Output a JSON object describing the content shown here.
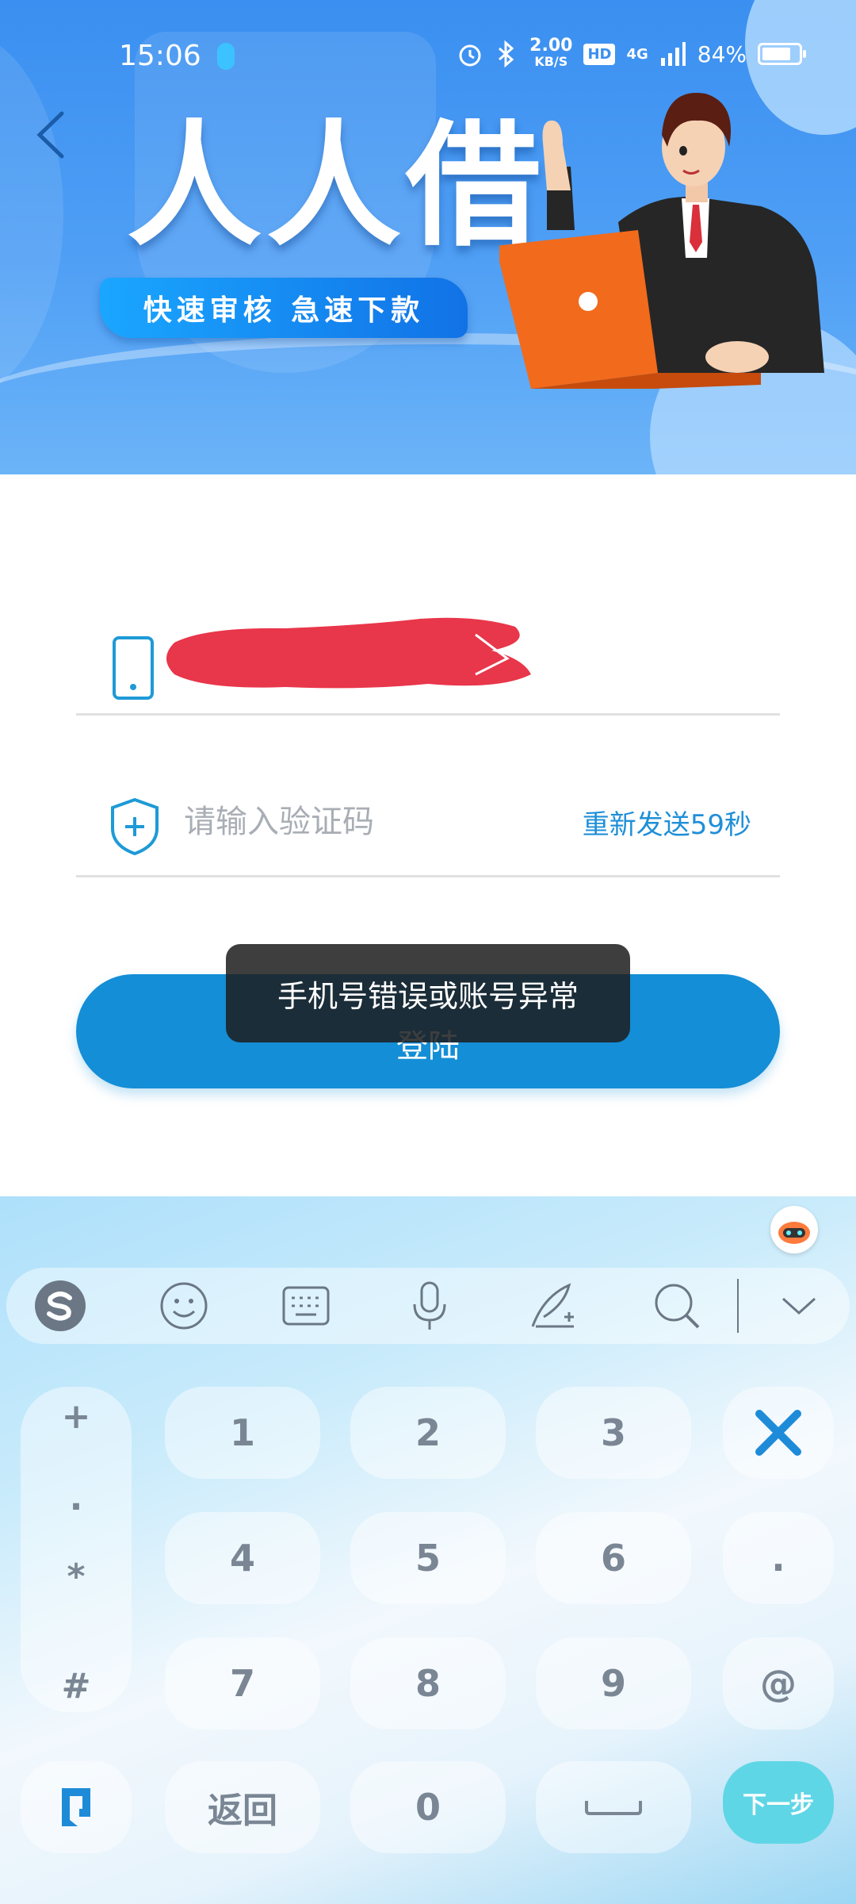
{
  "status_bar": {
    "time": "15:06",
    "net_speed_value": "2.00",
    "net_speed_unit": "KB/S",
    "hd_label": "HD",
    "network": "4G",
    "battery": "84%"
  },
  "banner": {
    "title": "人人借",
    "tagline": "快速审核 急速下款"
  },
  "form": {
    "phone_value": "",
    "code_placeholder": "请输入验证码",
    "resend_label": "重新发送59秒",
    "login_label": "登陆"
  },
  "toast": {
    "message": "手机号错误或账号异常"
  },
  "keyboard": {
    "symbols": [
      "+",
      ".",
      "*",
      "#"
    ],
    "row1": [
      "1",
      "2",
      "3"
    ],
    "row2": [
      "4",
      "5",
      "6"
    ],
    "row3": [
      "7",
      "8",
      "9"
    ],
    "dot_key": ".",
    "at_key": "@",
    "back_label": "返回",
    "zero": "0",
    "next_label": "下一步"
  },
  "colors": {
    "banner_blue": "#3a8ff0",
    "button_blue": "#148ed6",
    "link_blue": "#1f8fd8",
    "redaction_red": "#e8364a",
    "next_key": "#5fd6e6"
  }
}
